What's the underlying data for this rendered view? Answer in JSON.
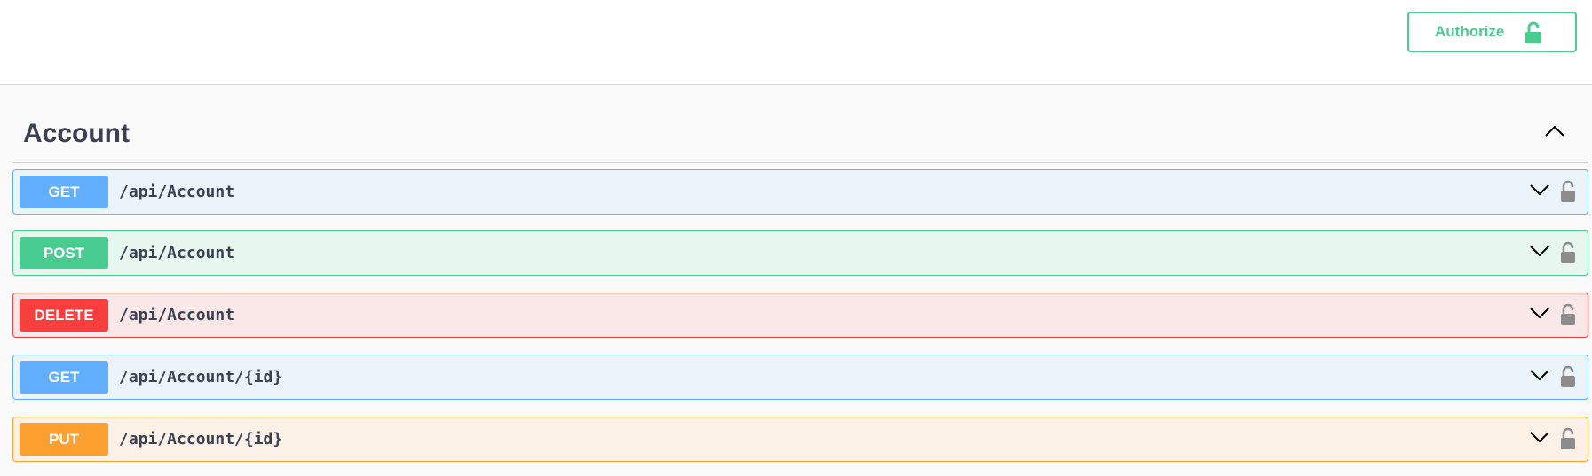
{
  "topbar": {
    "authorize_label": "Authorize",
    "authorize_icon": "unlocked-lock-icon",
    "accent_color": "#49cc90"
  },
  "tag": {
    "title": "Account",
    "toggle_icon": "chevron-up-icon"
  },
  "operations": [
    {
      "method": "GET",
      "path": "/api/Account",
      "color": "#61affe"
    },
    {
      "method": "POST",
      "path": "/api/Account",
      "color": "#49cc90"
    },
    {
      "method": "DELETE",
      "path": "/api/Account",
      "color": "#f93e3e"
    },
    {
      "method": "GET",
      "path": "/api/Account/{id}",
      "color": "#61affe"
    },
    {
      "method": "PUT",
      "path": "/api/Account/{id}",
      "color": "#fca130"
    }
  ],
  "operation_icons": {
    "expand": "chevron-down-icon",
    "auth": "unlocked-lock-icon"
  }
}
